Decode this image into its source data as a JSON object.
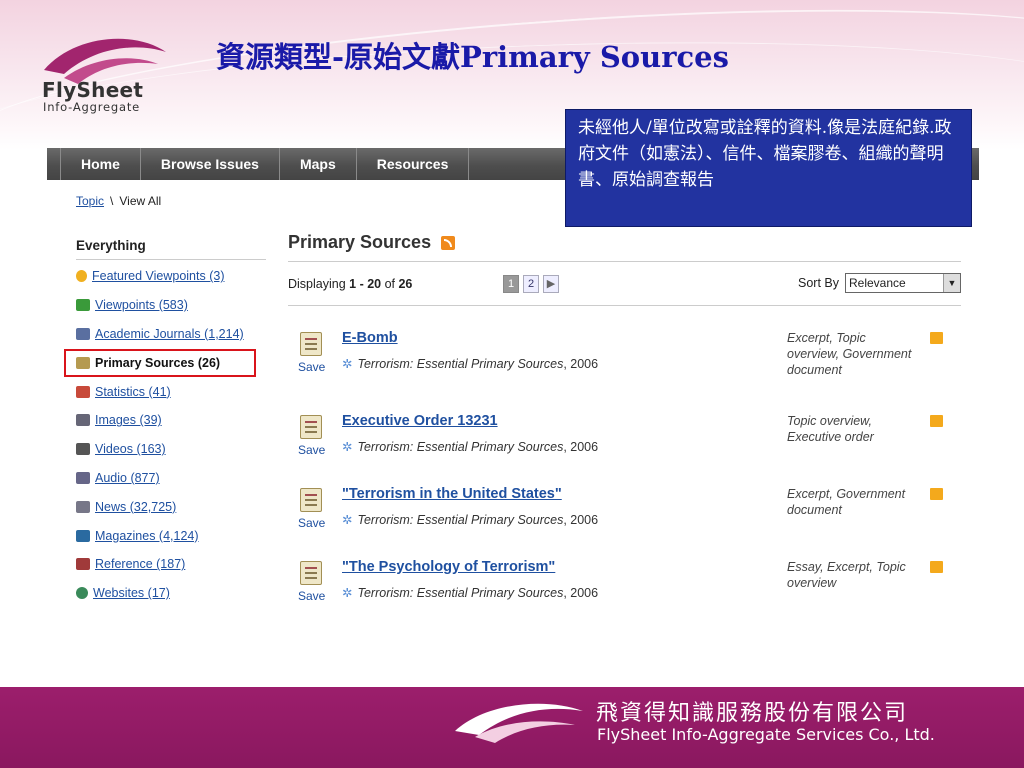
{
  "slide": {
    "title": "資源類型-原始文獻Primary Sources",
    "logo_text": "FlySheet",
    "logo_sub": "Info-Aggregate",
    "callout": "未經他人/單位改寫或詮釋的資料.像是法庭紀錄.政府文件（如憲法）、信件、檔案膠卷、組織的聲明書、原始調查報告",
    "footer_cn": "飛資得知識服務股份有限公司",
    "footer_en": "FlySheet Info-Aggregate Services Co., Ltd.",
    "colors": {
      "title": "#1a1aa8",
      "callout_bg": "#2233a0",
      "footer_bg": "#9c1e6c",
      "active_border": "#d9141b"
    }
  },
  "nav": [
    "Home",
    "Browse Issues",
    "Maps",
    "Resources"
  ],
  "breadcrumb": {
    "link": "Topic",
    "separator": "\\",
    "current": "View All"
  },
  "sidebar": {
    "heading": "Everything",
    "items": [
      {
        "label": "Featured Viewpoints (3)",
        "icon": "lightbulb-icon",
        "color": "#f0b020"
      },
      {
        "label": "Viewpoints (583)",
        "icon": "chat-bubbles-icon",
        "color": "#3a9a3a"
      },
      {
        "label": "Academic Journals (1,214)",
        "icon": "journal-icon",
        "color": "#5a6fa0"
      },
      {
        "label": "Primary Sources (26)",
        "icon": "scroll-icon",
        "color": "#b59a50",
        "active": true
      },
      {
        "label": "Statistics (41)",
        "icon": "bar-chart-icon",
        "color": "#c84a3a"
      },
      {
        "label": "Images (39)",
        "icon": "camera-icon",
        "color": "#667"
      },
      {
        "label": "Videos (163)",
        "icon": "video-icon",
        "color": "#555"
      },
      {
        "label": "Audio (877)",
        "icon": "speaker-icon",
        "color": "#668"
      },
      {
        "label": "News (32,725)",
        "icon": "newspaper-icon",
        "color": "#778"
      },
      {
        "label": "Magazines (4,124)",
        "icon": "magazine-icon",
        "color": "#2a6aa0"
      },
      {
        "label": "Reference (187)",
        "icon": "reference-book-icon",
        "color": "#a03a3a"
      },
      {
        "label": "Websites (17)",
        "icon": "globe-icon",
        "color": "#3a8a5a"
      }
    ]
  },
  "main": {
    "title": "Primary Sources",
    "displaying_prefix": "Displaying ",
    "range": "1 - 20",
    "of_text": " of ",
    "total": "26",
    "pages": [
      "1",
      "2"
    ],
    "next_symbol": "▶",
    "sort_label": "Sort By",
    "sort_value": "Relevance",
    "save_label": "Save",
    "results": [
      {
        "title": "E-Bomb",
        "source": "Terrorism: Essential Primary Sources",
        "year": ", 2006",
        "types": "Excerpt, Topic overview, Government document"
      },
      {
        "title": "Executive Order 13231",
        "source": "Terrorism: Essential Primary Sources",
        "year": ", 2006",
        "types": "Topic overview, Executive order"
      },
      {
        "title": "\"Terrorism in the United States\"",
        "source": "Terrorism: Essential Primary Sources",
        "year": ", 2006",
        "types": "Excerpt, Government document"
      },
      {
        "title": "\"The Psychology of Terrorism\"",
        "source": "Terrorism: Essential Primary Sources",
        "year": ", 2006",
        "types": "Essay, Excerpt, Topic overview"
      }
    ]
  }
}
